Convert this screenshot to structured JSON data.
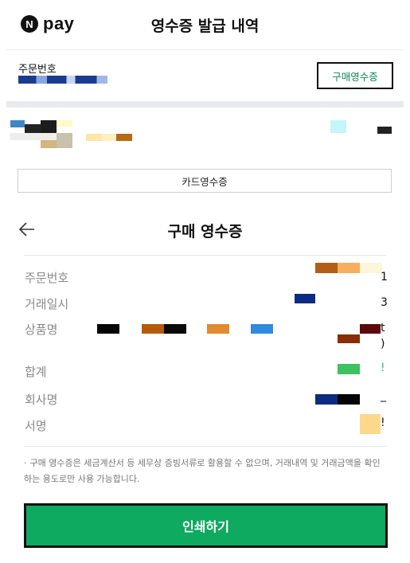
{
  "header": {
    "logo_mark": "N",
    "logo_text": "pay",
    "title": "영수증 발급 내역"
  },
  "order": {
    "label": "주문번호",
    "receipt_button": "구매영수증"
  },
  "card_receipt_button": "카드영수증",
  "section": {
    "title": "구매 영수증"
  },
  "details": {
    "rows": [
      {
        "label": "주문번호",
        "tail": "1"
      },
      {
        "label": "거래일시",
        "tail": "3"
      },
      {
        "label": "상품명",
        "tail": "t"
      },
      {
        "label": "합계",
        "tail": "!"
      },
      {
        "label": "회사명",
        "tail": "_"
      },
      {
        "label": "서명",
        "tail": "!"
      }
    ],
    "product_tail_2": ")"
  },
  "note": "구매 영수증은 세금계산서 등 세무상 증빙서류로 활용할 수 없으며, 거래내역 및 거래금액을 확인하는 용도로만 사용 가능합니다.",
  "print_button": "인쇄하기",
  "colors": {
    "brand_green": "#0eaa5f",
    "link_green": "#0a8a53"
  }
}
